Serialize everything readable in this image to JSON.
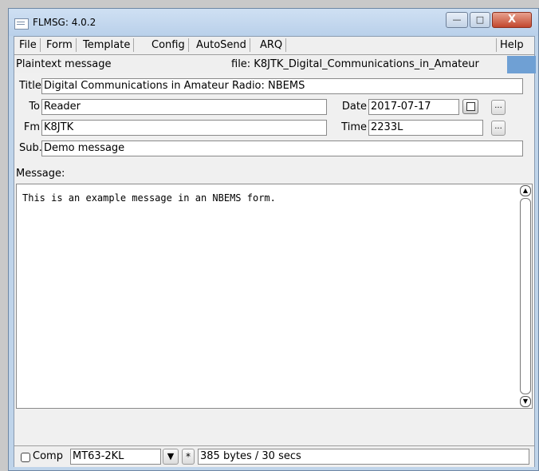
{
  "window": {
    "title": "FLMSG: 4.0.2",
    "min": "—",
    "max": "□",
    "close": "X"
  },
  "menu": {
    "file": "File",
    "form": "Form",
    "template": "Template",
    "config": "Config",
    "autosend": "AutoSend",
    "arq": "ARQ",
    "help": "Help"
  },
  "info": {
    "form_type": "Plaintext message",
    "file": "file: K8JTK_Digital_Communications_in_Amateur"
  },
  "form": {
    "title_label": "Title",
    "title_value": "Digital Communications in Amateur Radio: NBEMS",
    "to_label": "To",
    "to_value": "Reader",
    "date_label": "Date",
    "date_value": "2017-07-17",
    "fm_label": "Fm",
    "fm_value": "K8JTK",
    "time_label": "Time",
    "time_value": "2233L",
    "sub_label": "Sub.",
    "sub_value": "Demo message",
    "dots": "..."
  },
  "message": {
    "label": "Message:",
    "text": "This is an example message in an NBEMS form."
  },
  "status": {
    "comp_label": "Comp",
    "mode": "MT63-2KL",
    "star": "*",
    "info": "385 bytes / 30 secs"
  }
}
